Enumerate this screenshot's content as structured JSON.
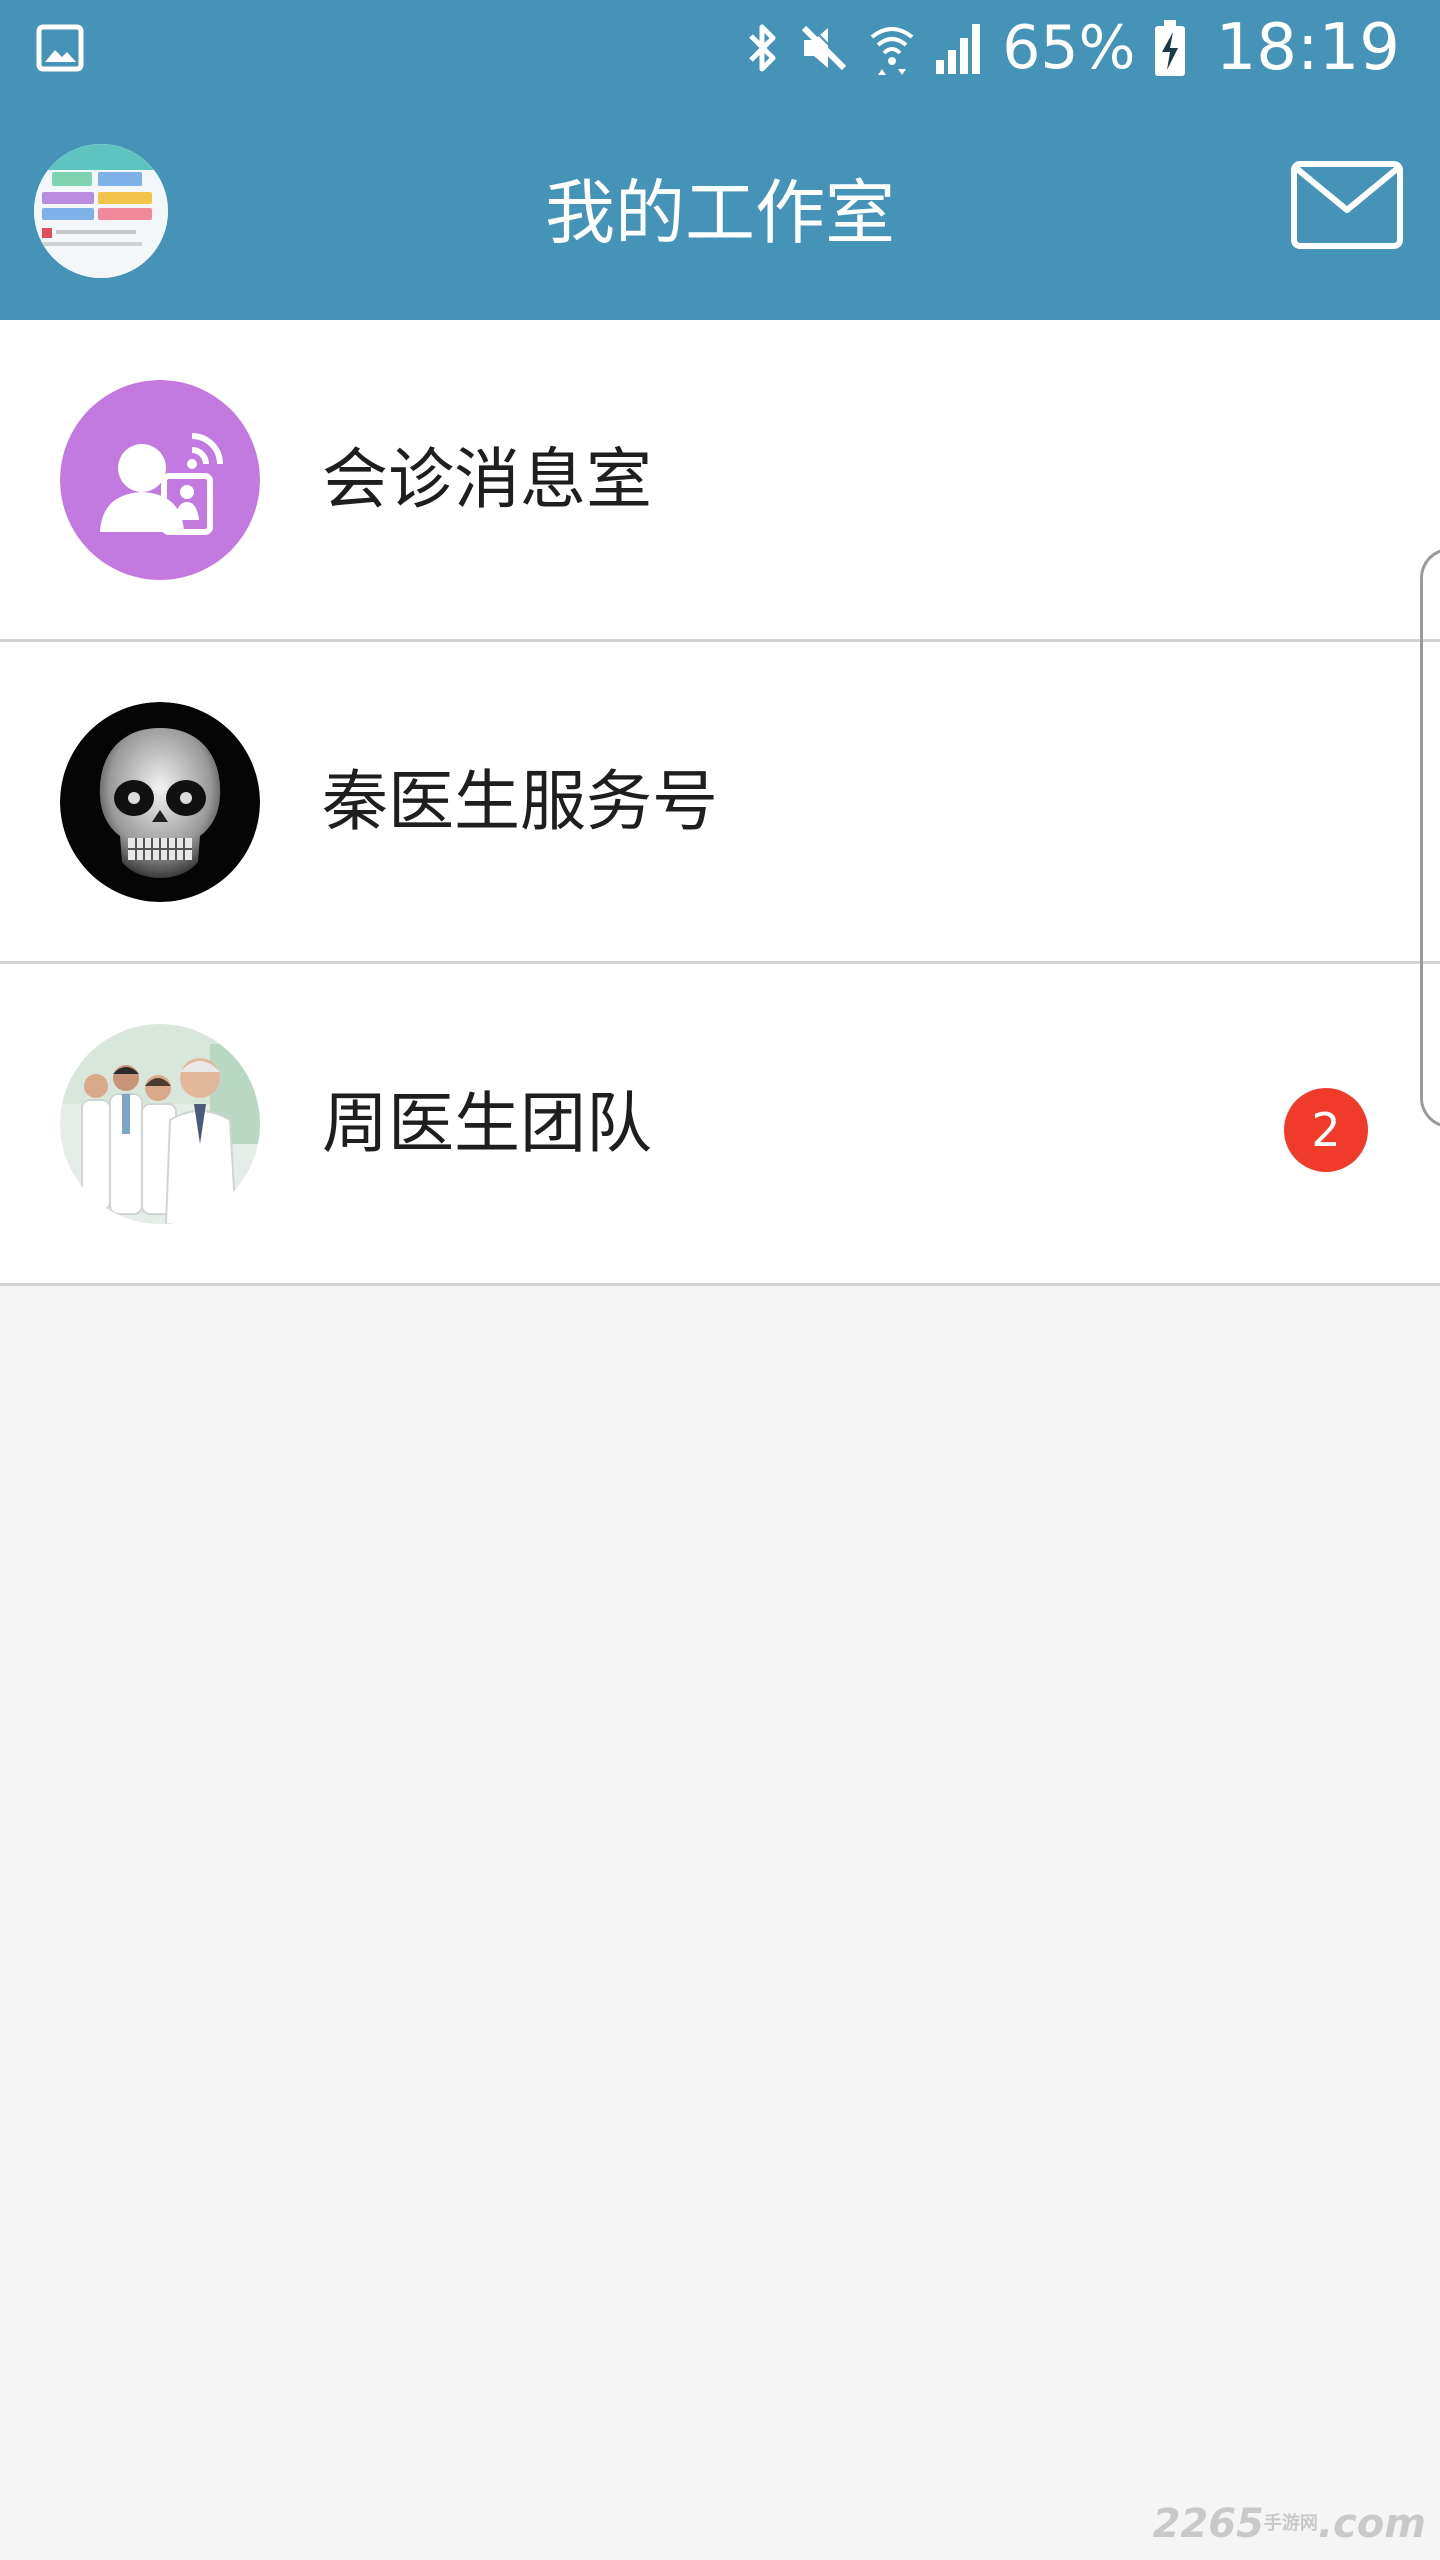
{
  "status_bar": {
    "battery_percent": "65%",
    "time": "18:19",
    "icons": [
      "gallery-icon",
      "bluetooth-icon",
      "mute-icon",
      "wifi-icon",
      "signal-icon",
      "battery-charging-icon"
    ]
  },
  "header": {
    "title": "我的工作室",
    "avatar_icon": "app-screenshot-avatar",
    "mail_icon": "mail-icon"
  },
  "list": {
    "items": [
      {
        "label": "会诊消息室",
        "avatar": "consultation-icon",
        "avatar_color": "#c27ae0"
      },
      {
        "label": "秦医生服务号",
        "avatar": "skull-avatar"
      },
      {
        "label": "周医生团队",
        "avatar": "doctors-team-photo",
        "badge": "2"
      }
    ]
  },
  "colors": {
    "header_bg": "#4593b7",
    "badge_bg": "#f03a2a",
    "page_bg": "#f5f5f5"
  },
  "watermark": {
    "text": "2265",
    "sub": "手游网",
    "domain": ".com"
  }
}
